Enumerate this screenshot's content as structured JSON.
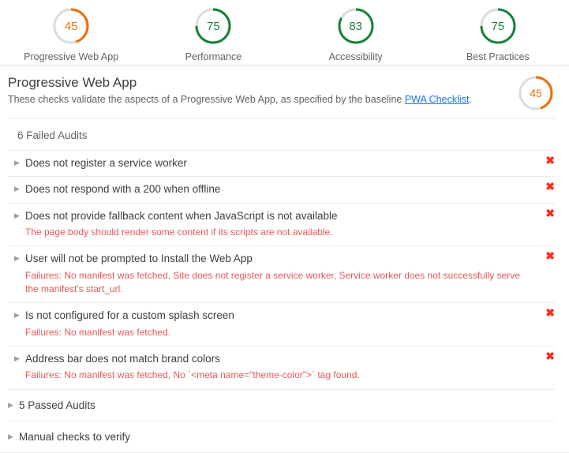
{
  "colors": {
    "orange": "#ef6c00",
    "green": "#178239",
    "track": "#dcdcdc",
    "fail_red": "#ff2a1a",
    "detail_red": "#eb5757",
    "link_blue": "#1a73e8"
  },
  "scores": [
    {
      "value": "45",
      "label": "Progressive Web App",
      "percent": 45,
      "color_key": "orange"
    },
    {
      "value": "75",
      "label": "Performance",
      "percent": 75,
      "color_key": "green"
    },
    {
      "value": "83",
      "label": "Accessibility",
      "percent": 83,
      "color_key": "green"
    },
    {
      "value": "75",
      "label": "Best Practices",
      "percent": 75,
      "color_key": "green"
    }
  ],
  "category": {
    "title": "Progressive Web App",
    "description_before": "These checks validate the aspects of a Progressive Web App, as specified by the baseline ",
    "description_link": "PWA Checklist",
    "description_after": ".",
    "gauge": {
      "value": "45",
      "percent": 45,
      "color_key": "orange"
    }
  },
  "failed_group": {
    "heading": "6 Failed Audits",
    "audits": [
      {
        "title": "Does not register a service worker",
        "detail": "",
        "status_icon": "fail-x-icon"
      },
      {
        "title": "Does not respond with a 200 when offline",
        "detail": "",
        "status_icon": "fail-x-icon"
      },
      {
        "title": "Does not provide fallback content when JavaScript is not available",
        "detail": "The page body should render some content if its scripts are not available.",
        "status_icon": "fail-x-icon"
      },
      {
        "title": "User will not be prompted to Install the Web App",
        "detail": "Failures: No manifest was fetched, Site does not register a service worker, Service worker does not successfully serve the manifest's start_url.",
        "status_icon": "fail-x-icon"
      },
      {
        "title": "Is not configured for a custom splash screen",
        "detail": "Failures: No manifest was fetched.",
        "status_icon": "fail-x-icon"
      },
      {
        "title": "Address bar does not match brand colors",
        "detail": "Failures: No manifest was fetched, No `<meta name=\"theme-color\">` tag found.",
        "status_icon": "fail-x-icon"
      }
    ]
  },
  "collapsed_groups": [
    {
      "label": "5 Passed Audits"
    },
    {
      "label": "Manual checks to verify"
    }
  ],
  "icons": {
    "expand_triangle": "▶",
    "fail_x": "✖"
  }
}
